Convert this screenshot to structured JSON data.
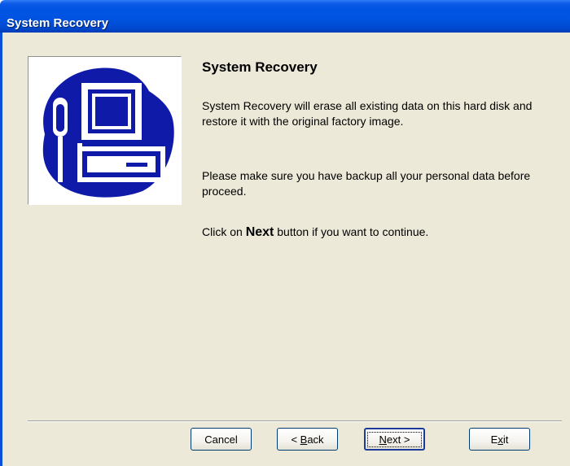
{
  "window": {
    "title": "System Recovery"
  },
  "content": {
    "heading": "System Recovery",
    "paragraph1": "System Recovery will erase all existing data on this hard disk and restore it with the original factory image.",
    "paragraph2": "Please make sure you have backup all your personal data before proceed.",
    "paragraph3_prefix": "Click on ",
    "paragraph3_bold": "Next",
    "paragraph3_suffix": " button if you want to continue.",
    "illustration_icon": "computer-with-screwdriver-icon"
  },
  "buttons": {
    "cancel": "Cancel",
    "back_prefix": "< ",
    "back_mnemonic": "B",
    "back_rest": "ack",
    "next_mnemonic": "N",
    "next_rest": "ext >",
    "exit_first": "E",
    "exit_mnemonic": "x",
    "exit_rest": "it"
  },
  "colors": {
    "titlebar": "#0054e3",
    "dialog_background": "#ece9d8",
    "illustration_blue": "#0f1aa8"
  }
}
